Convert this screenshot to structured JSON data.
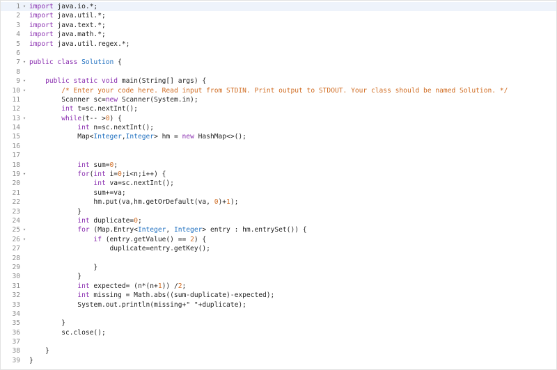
{
  "editor": {
    "language": "java",
    "active_line": 1,
    "colors": {
      "keyword": "#8a2fb0",
      "type": "#2070c0",
      "comment": "#d06c22",
      "number": "#d06c22",
      "text": "#222222",
      "line_number": "#8a8a8a",
      "active_line_bg": "#eef3fb"
    },
    "fold_marker_lines": [
      1,
      7,
      9,
      10,
      13,
      19,
      25,
      26
    ],
    "lines": [
      {
        "num": "1",
        "tokens": [
          {
            "t": "import",
            "c": "kw"
          },
          {
            "t": " java.io.*;"
          }
        ]
      },
      {
        "num": "2",
        "tokens": [
          {
            "t": "import",
            "c": "kw"
          },
          {
            "t": " java.util.*;"
          }
        ]
      },
      {
        "num": "3",
        "tokens": [
          {
            "t": "import",
            "c": "kw"
          },
          {
            "t": " java.text.*;"
          }
        ]
      },
      {
        "num": "4",
        "tokens": [
          {
            "t": "import",
            "c": "kw"
          },
          {
            "t": " java.math.*;"
          }
        ]
      },
      {
        "num": "5",
        "tokens": [
          {
            "t": "import",
            "c": "kw"
          },
          {
            "t": " java.util.regex.*;"
          }
        ]
      },
      {
        "num": "6",
        "tokens": []
      },
      {
        "num": "7",
        "tokens": [
          {
            "t": "public class ",
            "c": "kw"
          },
          {
            "t": "Solution",
            "c": "ty"
          },
          {
            "t": " {"
          }
        ]
      },
      {
        "num": "8",
        "tokens": []
      },
      {
        "num": "9",
        "tokens": [
          {
            "t": "    "
          },
          {
            "t": "public static void ",
            "c": "kw"
          },
          {
            "t": "main(String[] args) {"
          }
        ]
      },
      {
        "num": "10",
        "tokens": [
          {
            "t": "        "
          },
          {
            "t": "/* Enter your code here. Read input from STDIN. Print output to STDOUT. Your class should be named Solution. */",
            "c": "cm"
          }
        ]
      },
      {
        "num": "11",
        "tokens": [
          {
            "t": "        Scanner sc="
          },
          {
            "t": "new",
            "c": "kw"
          },
          {
            "t": " Scanner(System.in);"
          }
        ]
      },
      {
        "num": "12",
        "tokens": [
          {
            "t": "        "
          },
          {
            "t": "int",
            "c": "kw"
          },
          {
            "t": " t=sc.nextInt();"
          }
        ]
      },
      {
        "num": "13",
        "tokens": [
          {
            "t": "        "
          },
          {
            "t": "while",
            "c": "kw"
          },
          {
            "t": "(t-- >"
          },
          {
            "t": "0",
            "c": "num"
          },
          {
            "t": ") {"
          }
        ]
      },
      {
        "num": "14",
        "tokens": [
          {
            "t": "            "
          },
          {
            "t": "int",
            "c": "kw"
          },
          {
            "t": " n=sc.nextInt();"
          }
        ]
      },
      {
        "num": "15",
        "tokens": [
          {
            "t": "            Map<"
          },
          {
            "t": "Integer",
            "c": "ty"
          },
          {
            "t": ","
          },
          {
            "t": "Integer",
            "c": "ty"
          },
          {
            "t": "> hm = "
          },
          {
            "t": "new",
            "c": "kw"
          },
          {
            "t": " HashMap<>();"
          }
        ]
      },
      {
        "num": "16",
        "tokens": []
      },
      {
        "num": "17",
        "tokens": []
      },
      {
        "num": "18",
        "tokens": [
          {
            "t": "            "
          },
          {
            "t": "int",
            "c": "kw"
          },
          {
            "t": " sum="
          },
          {
            "t": "0",
            "c": "num"
          },
          {
            "t": ";"
          }
        ]
      },
      {
        "num": "19",
        "tokens": [
          {
            "t": "            "
          },
          {
            "t": "for",
            "c": "kw"
          },
          {
            "t": "("
          },
          {
            "t": "int",
            "c": "kw"
          },
          {
            "t": " i="
          },
          {
            "t": "0",
            "c": "num"
          },
          {
            "t": ";i<n;i++) {"
          }
        ]
      },
      {
        "num": "20",
        "tokens": [
          {
            "t": "                "
          },
          {
            "t": "int",
            "c": "kw"
          },
          {
            "t": " va=sc.nextInt();"
          }
        ]
      },
      {
        "num": "21",
        "tokens": [
          {
            "t": "                sum+=va;"
          }
        ]
      },
      {
        "num": "22",
        "tokens": [
          {
            "t": "                hm.put(va,hm.getOrDefault(va, "
          },
          {
            "t": "0",
            "c": "num"
          },
          {
            "t": ")+"
          },
          {
            "t": "1",
            "c": "num"
          },
          {
            "t": ");"
          }
        ]
      },
      {
        "num": "23",
        "tokens": [
          {
            "t": "            }"
          }
        ]
      },
      {
        "num": "24",
        "tokens": [
          {
            "t": "            "
          },
          {
            "t": "int",
            "c": "kw"
          },
          {
            "t": " duplicate="
          },
          {
            "t": "0",
            "c": "num"
          },
          {
            "t": ";"
          }
        ]
      },
      {
        "num": "25",
        "tokens": [
          {
            "t": "            "
          },
          {
            "t": "for",
            "c": "kw"
          },
          {
            "t": " (Map.Entry<"
          },
          {
            "t": "Integer",
            "c": "ty"
          },
          {
            "t": ", "
          },
          {
            "t": "Integer",
            "c": "ty"
          },
          {
            "t": "> entry : hm.entrySet()) {"
          }
        ]
      },
      {
        "num": "26",
        "tokens": [
          {
            "t": "                "
          },
          {
            "t": "if",
            "c": "kw"
          },
          {
            "t": " (entry.getValue() == "
          },
          {
            "t": "2",
            "c": "num"
          },
          {
            "t": ") {"
          }
        ]
      },
      {
        "num": "27",
        "tokens": [
          {
            "t": "                    duplicate=entry.getKey();"
          }
        ]
      },
      {
        "num": "28",
        "tokens": []
      },
      {
        "num": "29",
        "tokens": [
          {
            "t": "                }"
          }
        ]
      },
      {
        "num": "30",
        "tokens": [
          {
            "t": "            }"
          }
        ]
      },
      {
        "num": "31",
        "tokens": [
          {
            "t": "            "
          },
          {
            "t": "int",
            "c": "kw"
          },
          {
            "t": " expected= (n*(n+"
          },
          {
            "t": "1",
            "c": "num"
          },
          {
            "t": ")) /"
          },
          {
            "t": "2",
            "c": "num"
          },
          {
            "t": ";"
          }
        ]
      },
      {
        "num": "32",
        "tokens": [
          {
            "t": "            "
          },
          {
            "t": "int",
            "c": "kw"
          },
          {
            "t": " missing = Math.abs((sum-duplicate)-expected);"
          }
        ]
      },
      {
        "num": "33",
        "tokens": [
          {
            "t": "            System.out.println(missing+\" \"+duplicate);"
          }
        ]
      },
      {
        "num": "34",
        "tokens": []
      },
      {
        "num": "35",
        "tokens": [
          {
            "t": "        }"
          }
        ]
      },
      {
        "num": "36",
        "tokens": [
          {
            "t": "        sc.close();"
          }
        ]
      },
      {
        "num": "37",
        "tokens": []
      },
      {
        "num": "38",
        "tokens": [
          {
            "t": "    }"
          }
        ]
      },
      {
        "num": "39",
        "tokens": [
          {
            "t": "}"
          }
        ]
      }
    ]
  }
}
